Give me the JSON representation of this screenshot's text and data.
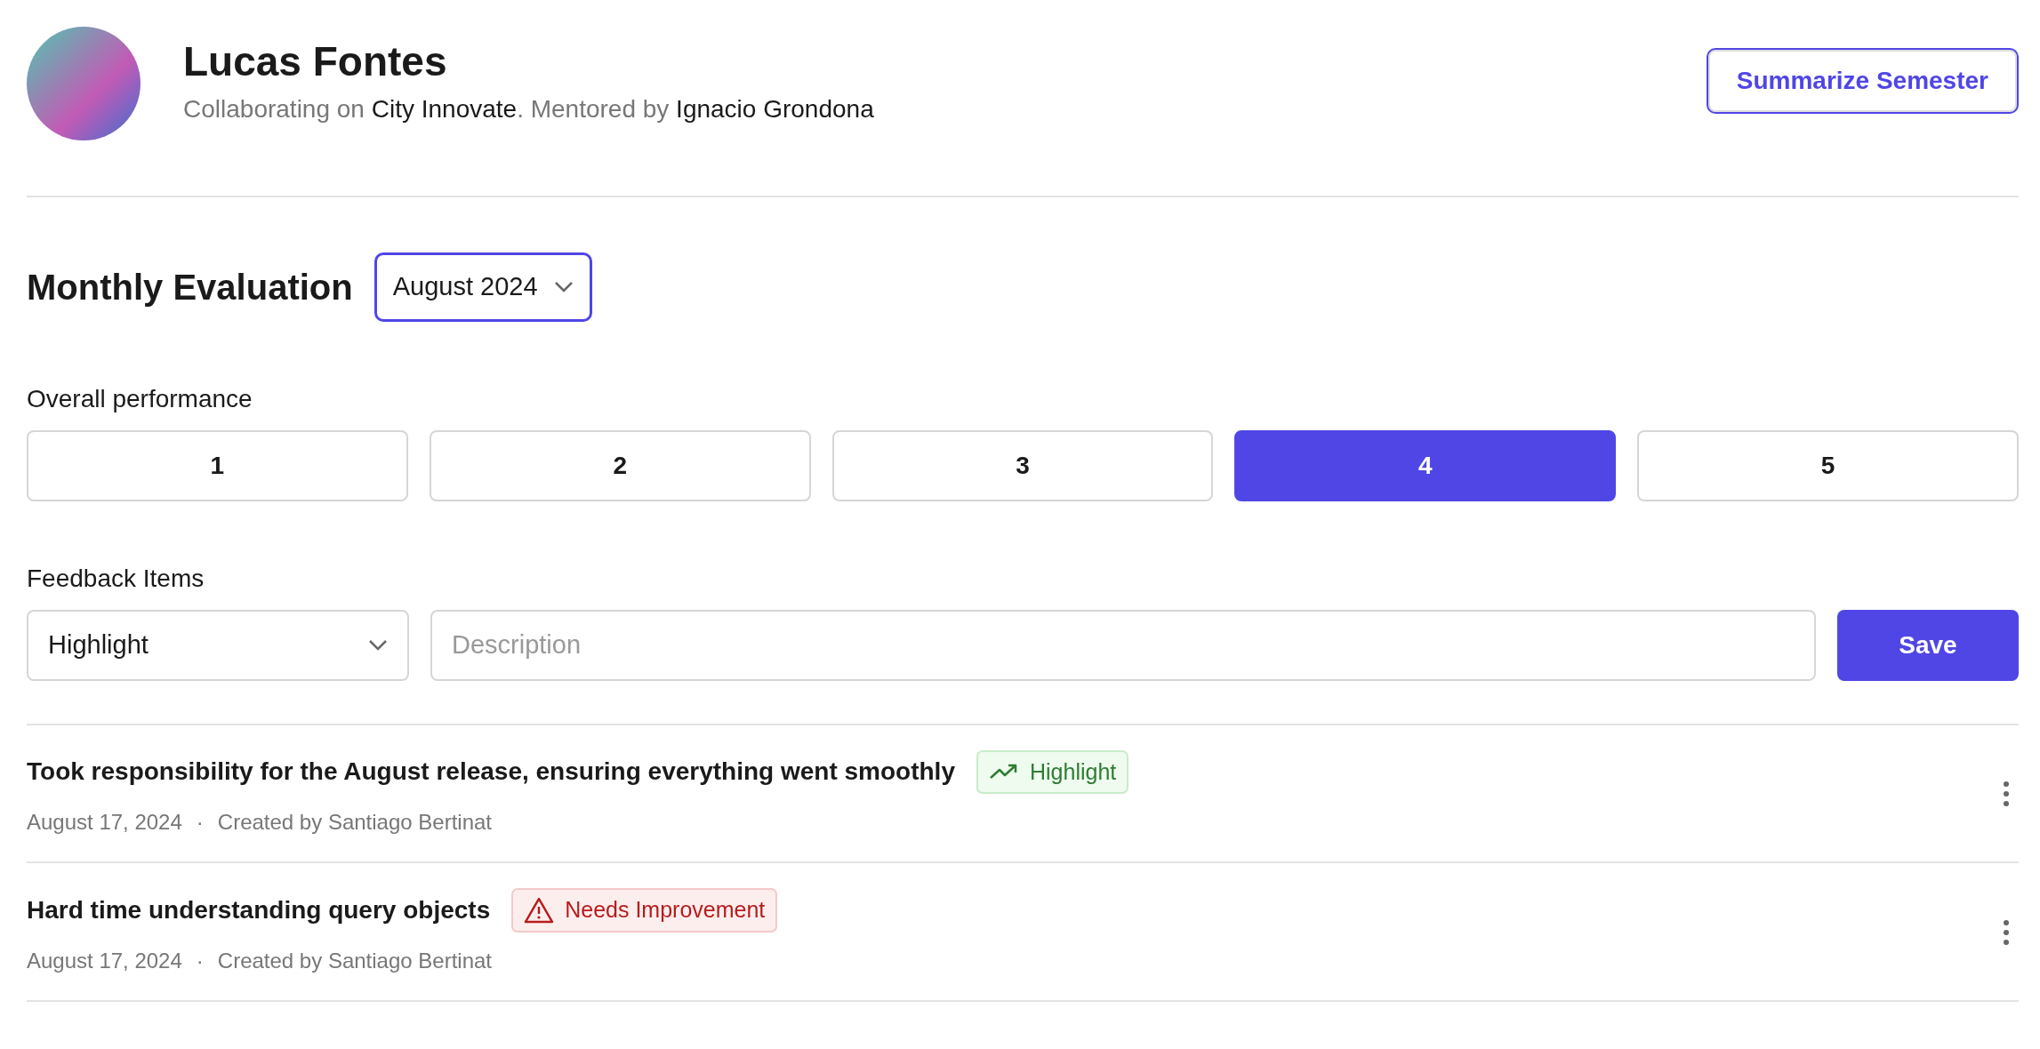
{
  "profile": {
    "name": "Lucas Fontes",
    "subtitle": [
      {
        "text": "Collaborating on ",
        "emphasis": false
      },
      {
        "text": "City Innovate",
        "emphasis": true
      },
      {
        "text": ". Mentored by ",
        "emphasis": false
      },
      {
        "text": "Ignacio Grondona",
        "emphasis": true
      }
    ],
    "action": "Summarize Semester"
  },
  "evaluation": {
    "title": "Monthly Evaluation",
    "month": "August 2024"
  },
  "performance": {
    "label": "Overall performance",
    "options": [
      {
        "label": "1",
        "selected": false
      },
      {
        "label": "2",
        "selected": false
      },
      {
        "label": "3",
        "selected": false
      },
      {
        "label": "4",
        "selected": true
      },
      {
        "label": "5",
        "selected": false
      }
    ]
  },
  "feedback": {
    "label": "Feedback Items",
    "type": "Highlight",
    "placeholder": "Description",
    "save": "Save",
    "items": [
      {
        "text": "Took responsibility for the August release, ensuring everything went smoothly",
        "kind": "highlight",
        "tag": "Highlight",
        "date": "August 17, 2024",
        "separator": "·",
        "author": "Created by Santiago Bertinat"
      },
      {
        "text": "Hard time understanding query objects",
        "kind": "improvement",
        "tag": "Needs Improvement",
        "date": "August 17, 2024",
        "separator": "·",
        "author": "Created by Santiago Bertinat"
      }
    ]
  }
}
